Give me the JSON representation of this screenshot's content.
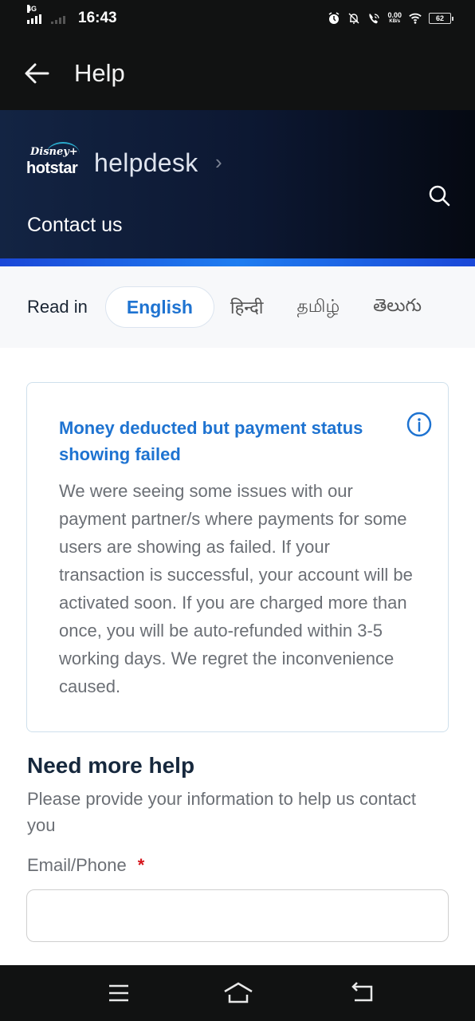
{
  "status_bar": {
    "network": "4G",
    "time": "16:43",
    "speed_value": "0.00",
    "speed_unit": "KB/s",
    "battery": "62",
    "icons": [
      "signal-icon",
      "signal-weak-icon",
      "alarm-icon",
      "bell-off-icon",
      "wifi-calling-icon",
      "wifi-icon",
      "battery-icon"
    ]
  },
  "app_bar": {
    "title": "Help",
    "back_icon": "arrow-left-icon"
  },
  "hero": {
    "logo_top": "Disney+",
    "logo_bottom": "hotstar",
    "breadcrumb": "helpdesk",
    "breadcrumb_chevron": "›",
    "page_title": "Contact us",
    "search_icon": "search-icon",
    "colors": {
      "accent_bar": "#1e7df0",
      "background": "#0c1731"
    }
  },
  "language": {
    "label": "Read in",
    "selected": "English",
    "options": [
      "हिन्दी",
      "தமிழ்",
      "తెలుగు"
    ],
    "accent": "#1e73d1"
  },
  "notice": {
    "title": "Money deducted but payment status showing failed",
    "body": "We were seeing some issues with our payment partner/s where payments for some users are showing as failed. If your transaction is successful, your account will be activated soon. If you are charged more than once, you will be auto-refunded within 3-5 working days. We regret the inconvenience caused.",
    "icon": "info-icon"
  },
  "form": {
    "heading": "Need more help",
    "subheading": "Please provide your information to help us contact you",
    "email_label": "Email/Phone",
    "required_marker": "*",
    "email_value": "",
    "email_placeholder": ""
  },
  "nav_bar": {
    "buttons": [
      "menu-icon",
      "home-icon",
      "back-icon"
    ]
  }
}
